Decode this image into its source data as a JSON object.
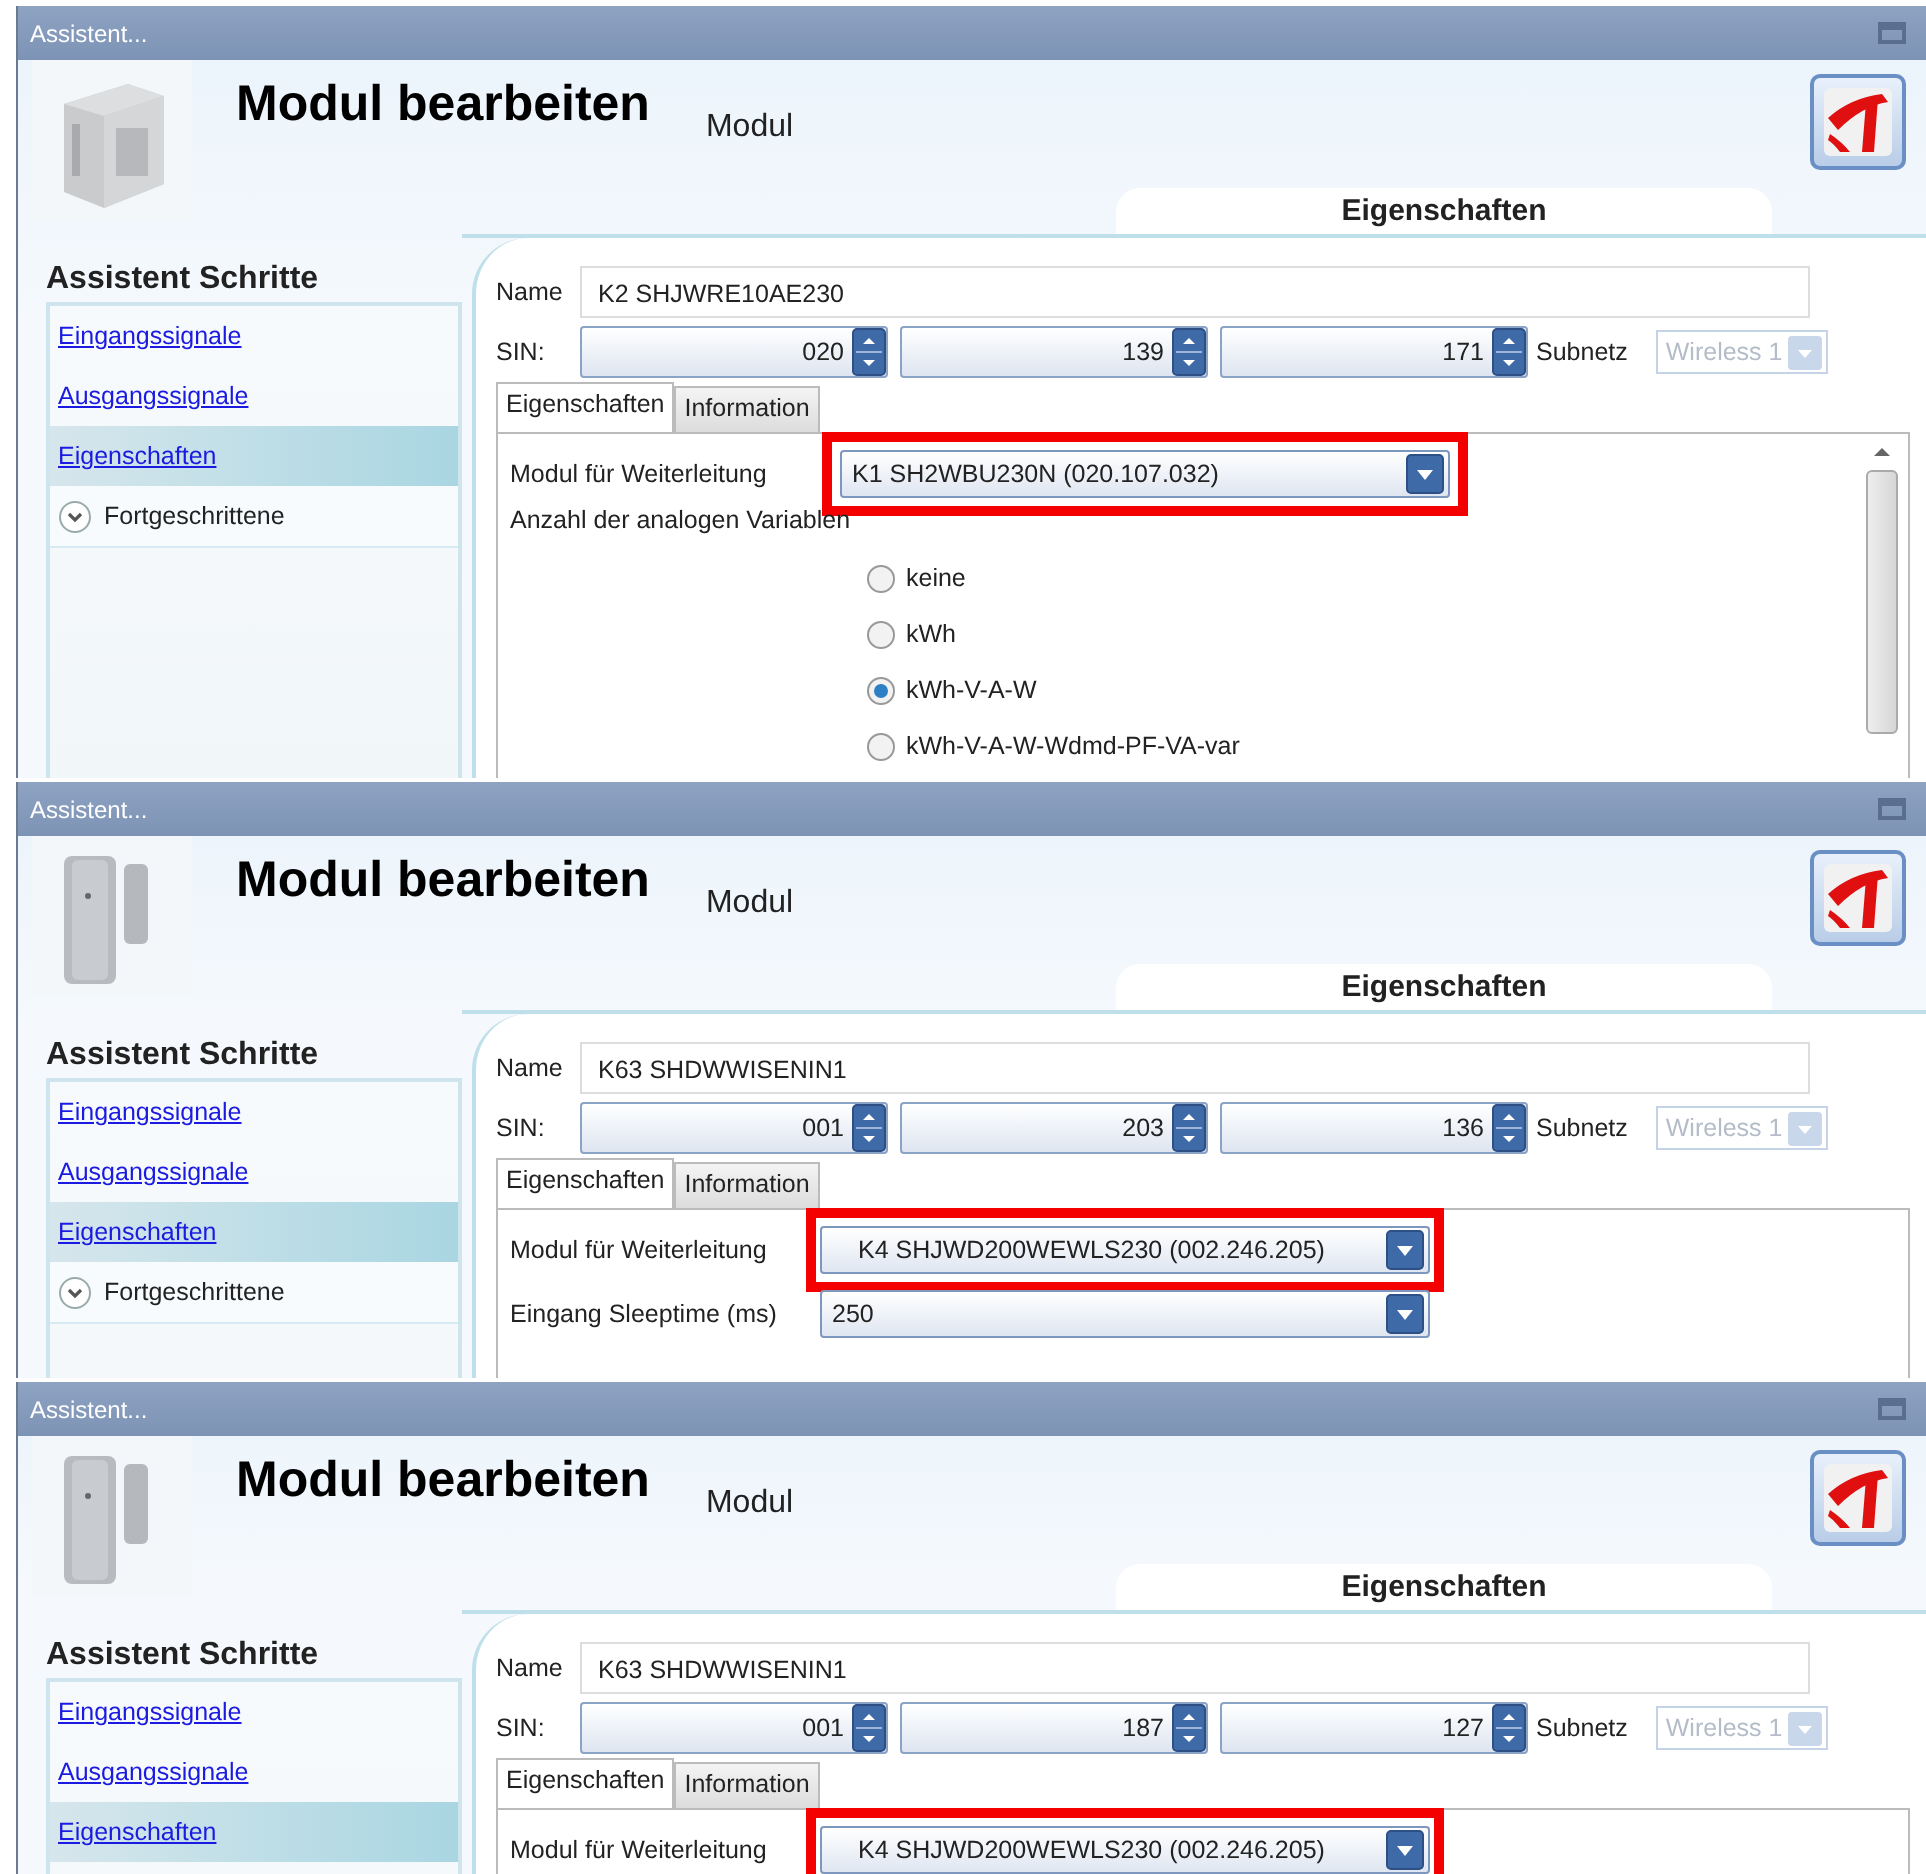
{
  "panels": [
    {
      "title": "Assistent...",
      "heading": "Modul bearbeiten",
      "subtitle": "Modul",
      "section": "Eigenschaften",
      "steps_title": "Assistent Schritte",
      "scrollable": true,
      "steps": [
        {
          "kind": "link",
          "label": "Eingangssignale",
          "selected": false
        },
        {
          "kind": "link",
          "label": "Ausgangssignale",
          "selected": false
        },
        {
          "kind": "link",
          "label": "Eigenschaften",
          "selected": true
        },
        {
          "kind": "expander",
          "label": "Fortgeschrittene",
          "selected": false
        }
      ],
      "name_label": "Name",
      "name": "K2 SHJWRE10AE230",
      "sin_label": "SIN:",
      "sin": [
        "020",
        "139",
        "171"
      ],
      "subnet_label": "Subnetz",
      "subnet": "Wireless 1",
      "tabs": [
        {
          "label": "Eigenschaften",
          "selected": true
        },
        {
          "label": "Information",
          "selected": false
        }
      ],
      "fields": [
        {
          "kind": "select",
          "label": "Modul für Weiterleitung",
          "value": "K1 SH2WBU230N (020.107.032)",
          "highlighted": true
        },
        {
          "kind": "radio",
          "label": "Anzahl der analogen Variablen",
          "options": [
            {
              "label": "keine",
              "selected": false
            },
            {
              "label": "kWh",
              "selected": false
            },
            {
              "label": "kWh-V-A-W",
              "selected": true
            },
            {
              "label": "kWh-V-A-W-Wdmd-PF-VA-var",
              "selected": false
            }
          ]
        }
      ]
    },
    {
      "title": "Assistent...",
      "heading": "Modul bearbeiten",
      "subtitle": "Modul",
      "section": "Eigenschaften",
      "steps_title": "Assistent Schritte",
      "steps": [
        {
          "kind": "link",
          "label": "Eingangssignale",
          "selected": false
        },
        {
          "kind": "link",
          "label": "Ausgangssignale",
          "selected": false
        },
        {
          "kind": "link",
          "label": "Eigenschaften",
          "selected": true
        },
        {
          "kind": "expander",
          "label": "Fortgeschrittene",
          "selected": false
        }
      ],
      "name_label": "Name",
      "name": "K63 SHDWWISENIN1",
      "sin_label": "SIN:",
      "sin": [
        "001",
        "203",
        "136"
      ],
      "subnet_label": "Subnetz",
      "subnet": "Wireless 1",
      "tabs": [
        {
          "label": "Eigenschaften",
          "selected": true
        },
        {
          "label": "Information",
          "selected": false
        }
      ],
      "fields": [
        {
          "kind": "select",
          "label": "Modul für Weiterleitung",
          "value": "K4 SHJWD200WEWLS230 (002.246.205)",
          "highlighted": true
        },
        {
          "kind": "select",
          "label": "Eingang Sleeptime (ms)",
          "value": "250",
          "highlighted": false
        }
      ]
    },
    {
      "title": "Assistent...",
      "heading": "Modul bearbeiten",
      "subtitle": "Modul",
      "section": "Eigenschaften",
      "steps_title": "Assistent Schritte",
      "steps": [
        {
          "kind": "link",
          "label": "Eingangssignale",
          "selected": false
        },
        {
          "kind": "link",
          "label": "Ausgangssignale",
          "selected": false
        },
        {
          "kind": "link",
          "label": "Eigenschaften",
          "selected": true
        }
      ],
      "name_label": "Name",
      "name": "K63 SHDWWISENIN1",
      "sin_label": "SIN:",
      "sin": [
        "001",
        "187",
        "127"
      ],
      "subnet_label": "Subnetz",
      "subnet": "Wireless 1",
      "tabs": [
        {
          "label": "Eigenschaften",
          "selected": true
        },
        {
          "label": "Information",
          "selected": false
        }
      ],
      "fields": [
        {
          "kind": "select",
          "label": "Modul für Weiterleitung",
          "value": "K4 SHJWD200WEWLS230 (002.246.205)",
          "highlighted": true
        }
      ]
    }
  ]
}
